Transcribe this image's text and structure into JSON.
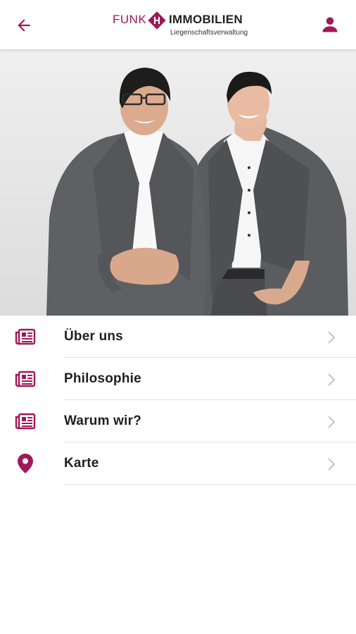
{
  "colors": {
    "accent": "#a0185a",
    "text": "#1f1f1f",
    "chevron": "#c4c4c4",
    "divider": "#e3e3e3"
  },
  "header": {
    "back_icon": "arrow-left-icon",
    "profile_icon": "user-icon",
    "logo": {
      "word1": "FUNK",
      "word2": "IMMOBILIEN",
      "subtitle": "Liegenschaftsverwaltung"
    }
  },
  "menu": {
    "items": [
      {
        "label": "Über uns",
        "icon": "newspaper-icon"
      },
      {
        "label": "Philosophie",
        "icon": "newspaper-icon"
      },
      {
        "label": "Warum wir?",
        "icon": "newspaper-icon"
      },
      {
        "label": "Karte",
        "icon": "map-pin-icon"
      }
    ]
  }
}
